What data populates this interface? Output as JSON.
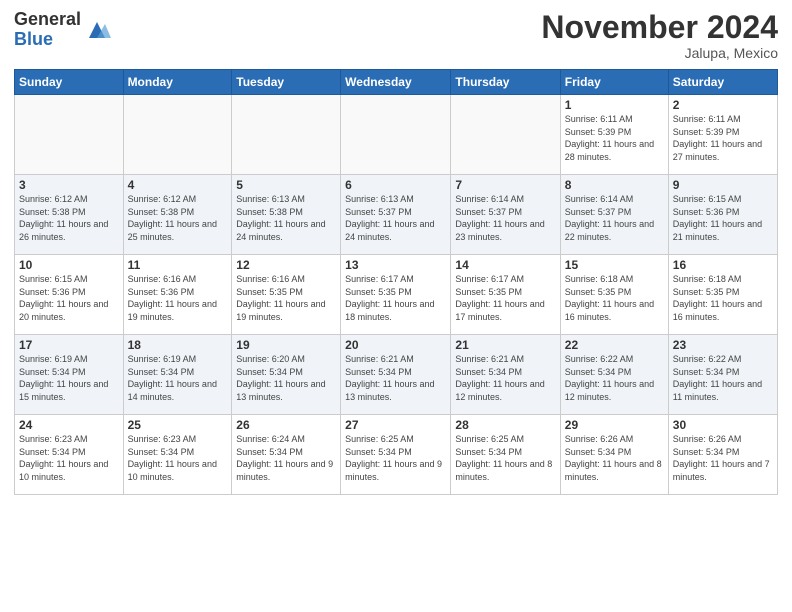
{
  "header": {
    "logo_general": "General",
    "logo_blue": "Blue",
    "month_title": "November 2024",
    "location": "Jalupa, Mexico"
  },
  "days_of_week": [
    "Sunday",
    "Monday",
    "Tuesday",
    "Wednesday",
    "Thursday",
    "Friday",
    "Saturday"
  ],
  "weeks": [
    {
      "shade": false,
      "days": [
        {
          "number": "",
          "info": ""
        },
        {
          "number": "",
          "info": ""
        },
        {
          "number": "",
          "info": ""
        },
        {
          "number": "",
          "info": ""
        },
        {
          "number": "",
          "info": ""
        },
        {
          "number": "1",
          "info": "Sunrise: 6:11 AM\nSunset: 5:39 PM\nDaylight: 11 hours and 28 minutes."
        },
        {
          "number": "2",
          "info": "Sunrise: 6:11 AM\nSunset: 5:39 PM\nDaylight: 11 hours and 27 minutes."
        }
      ]
    },
    {
      "shade": true,
      "days": [
        {
          "number": "3",
          "info": "Sunrise: 6:12 AM\nSunset: 5:38 PM\nDaylight: 11 hours and 26 minutes."
        },
        {
          "number": "4",
          "info": "Sunrise: 6:12 AM\nSunset: 5:38 PM\nDaylight: 11 hours and 25 minutes."
        },
        {
          "number": "5",
          "info": "Sunrise: 6:13 AM\nSunset: 5:38 PM\nDaylight: 11 hours and 24 minutes."
        },
        {
          "number": "6",
          "info": "Sunrise: 6:13 AM\nSunset: 5:37 PM\nDaylight: 11 hours and 24 minutes."
        },
        {
          "number": "7",
          "info": "Sunrise: 6:14 AM\nSunset: 5:37 PM\nDaylight: 11 hours and 23 minutes."
        },
        {
          "number": "8",
          "info": "Sunrise: 6:14 AM\nSunset: 5:37 PM\nDaylight: 11 hours and 22 minutes."
        },
        {
          "number": "9",
          "info": "Sunrise: 6:15 AM\nSunset: 5:36 PM\nDaylight: 11 hours and 21 minutes."
        }
      ]
    },
    {
      "shade": false,
      "days": [
        {
          "number": "10",
          "info": "Sunrise: 6:15 AM\nSunset: 5:36 PM\nDaylight: 11 hours and 20 minutes."
        },
        {
          "number": "11",
          "info": "Sunrise: 6:16 AM\nSunset: 5:36 PM\nDaylight: 11 hours and 19 minutes."
        },
        {
          "number": "12",
          "info": "Sunrise: 6:16 AM\nSunset: 5:35 PM\nDaylight: 11 hours and 19 minutes."
        },
        {
          "number": "13",
          "info": "Sunrise: 6:17 AM\nSunset: 5:35 PM\nDaylight: 11 hours and 18 minutes."
        },
        {
          "number": "14",
          "info": "Sunrise: 6:17 AM\nSunset: 5:35 PM\nDaylight: 11 hours and 17 minutes."
        },
        {
          "number": "15",
          "info": "Sunrise: 6:18 AM\nSunset: 5:35 PM\nDaylight: 11 hours and 16 minutes."
        },
        {
          "number": "16",
          "info": "Sunrise: 6:18 AM\nSunset: 5:35 PM\nDaylight: 11 hours and 16 minutes."
        }
      ]
    },
    {
      "shade": true,
      "days": [
        {
          "number": "17",
          "info": "Sunrise: 6:19 AM\nSunset: 5:34 PM\nDaylight: 11 hours and 15 minutes."
        },
        {
          "number": "18",
          "info": "Sunrise: 6:19 AM\nSunset: 5:34 PM\nDaylight: 11 hours and 14 minutes."
        },
        {
          "number": "19",
          "info": "Sunrise: 6:20 AM\nSunset: 5:34 PM\nDaylight: 11 hours and 13 minutes."
        },
        {
          "number": "20",
          "info": "Sunrise: 6:21 AM\nSunset: 5:34 PM\nDaylight: 11 hours and 13 minutes."
        },
        {
          "number": "21",
          "info": "Sunrise: 6:21 AM\nSunset: 5:34 PM\nDaylight: 11 hours and 12 minutes."
        },
        {
          "number": "22",
          "info": "Sunrise: 6:22 AM\nSunset: 5:34 PM\nDaylight: 11 hours and 12 minutes."
        },
        {
          "number": "23",
          "info": "Sunrise: 6:22 AM\nSunset: 5:34 PM\nDaylight: 11 hours and 11 minutes."
        }
      ]
    },
    {
      "shade": false,
      "days": [
        {
          "number": "24",
          "info": "Sunrise: 6:23 AM\nSunset: 5:34 PM\nDaylight: 11 hours and 10 minutes."
        },
        {
          "number": "25",
          "info": "Sunrise: 6:23 AM\nSunset: 5:34 PM\nDaylight: 11 hours and 10 minutes."
        },
        {
          "number": "26",
          "info": "Sunrise: 6:24 AM\nSunset: 5:34 PM\nDaylight: 11 hours and 9 minutes."
        },
        {
          "number": "27",
          "info": "Sunrise: 6:25 AM\nSunset: 5:34 PM\nDaylight: 11 hours and 9 minutes."
        },
        {
          "number": "28",
          "info": "Sunrise: 6:25 AM\nSunset: 5:34 PM\nDaylight: 11 hours and 8 minutes."
        },
        {
          "number": "29",
          "info": "Sunrise: 6:26 AM\nSunset: 5:34 PM\nDaylight: 11 hours and 8 minutes."
        },
        {
          "number": "30",
          "info": "Sunrise: 6:26 AM\nSunset: 5:34 PM\nDaylight: 11 hours and 7 minutes."
        }
      ]
    }
  ]
}
